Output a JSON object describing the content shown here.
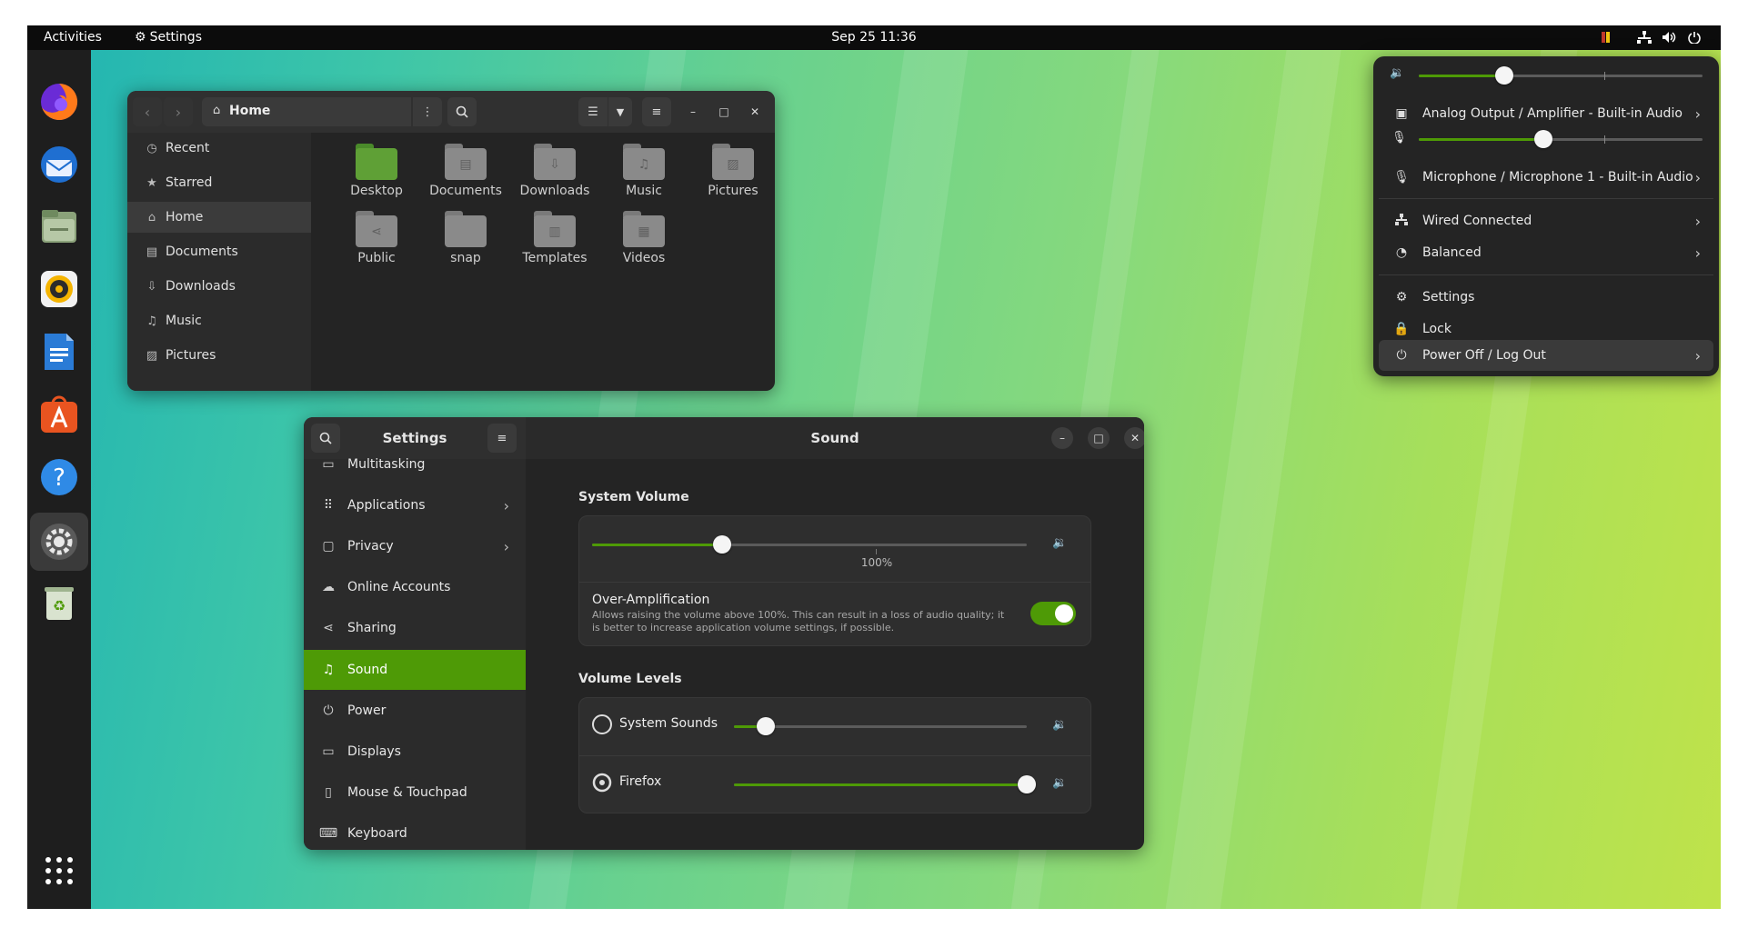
{
  "topbar": {
    "activities": "Activities",
    "app_name": "Settings",
    "datetime": "Sep 25  11:36"
  },
  "dock": {
    "icons": [
      "firefox-icon",
      "thunderbird-icon",
      "files-icon",
      "rhythmbox-icon",
      "writer-icon",
      "app-center-icon",
      "help-icon",
      "settings-icon",
      "trash-icon",
      "show-apps-icon"
    ]
  },
  "files": {
    "location": "Home",
    "sidebar": [
      {
        "label": "Recent",
        "icon": "◷"
      },
      {
        "label": "Starred",
        "icon": "★"
      },
      {
        "label": "Home",
        "icon": "⌂"
      },
      {
        "label": "Documents",
        "icon": "▤"
      },
      {
        "label": "Downloads",
        "icon": "⇩"
      },
      {
        "label": "Music",
        "icon": "♫"
      },
      {
        "label": "Pictures",
        "icon": "▨"
      }
    ],
    "folders": [
      {
        "label": "Desktop",
        "glyph": ""
      },
      {
        "label": "Documents",
        "glyph": "▤"
      },
      {
        "label": "Downloads",
        "glyph": "⇩"
      },
      {
        "label": "Music",
        "glyph": "♫"
      },
      {
        "label": "Pictures",
        "glyph": "▨"
      },
      {
        "label": "Public",
        "glyph": "⋖"
      },
      {
        "label": "snap",
        "glyph": ""
      },
      {
        "label": "Templates",
        "glyph": "▥"
      },
      {
        "label": "Videos",
        "glyph": "▦"
      }
    ]
  },
  "settings": {
    "sidebar_title": "Settings",
    "page_title": "Sound",
    "sidebar": [
      {
        "label": "Multitasking",
        "icon": "▭",
        "chevron": ""
      },
      {
        "label": "Applications",
        "icon": "⠿",
        "chevron": "›"
      },
      {
        "label": "Privacy",
        "icon": "▢",
        "chevron": "›"
      },
      {
        "label": "Online Accounts",
        "icon": "☁",
        "chevron": ""
      },
      {
        "label": "Sharing",
        "icon": "⋖",
        "chevron": ""
      },
      {
        "label": "Sound",
        "icon": "♫",
        "chevron": ""
      },
      {
        "label": "Power",
        "icon": "⏻",
        "chevron": ""
      },
      {
        "label": "Displays",
        "icon": "▭",
        "chevron": ""
      },
      {
        "label": "Mouse & Touchpad",
        "icon": "▯",
        "chevron": ""
      },
      {
        "label": "Keyboard",
        "icon": "⌨",
        "chevron": ""
      }
    ],
    "system_volume": {
      "heading": "System Volume",
      "value": 0.3,
      "mark_label": "100%",
      "over_amp_title": "Over-Amplification",
      "over_amp_desc": "Allows raising the volume above 100%. This can result in a loss of audio quality; it is better to increase application volume settings, if possible.",
      "over_amp_on": true
    },
    "volume_levels": {
      "heading": "Volume Levels",
      "items": [
        {
          "label": "System Sounds",
          "value": 0.11
        },
        {
          "label": "Firefox",
          "value": 1.0
        }
      ]
    }
  },
  "quick_settings": {
    "output_volume": 0.3,
    "output_label": "Analog Output / Amplifier - Built-in Audio",
    "input_volume": 0.44,
    "input_label": "Microphone / Microphone 1 - Built-in Audio",
    "network": "Wired Connected",
    "power_mode": "Balanced",
    "settings": "Settings",
    "lock": "Lock",
    "power": "Power Off / Log Out"
  },
  "colors": {
    "accent": "#4e9a06"
  }
}
